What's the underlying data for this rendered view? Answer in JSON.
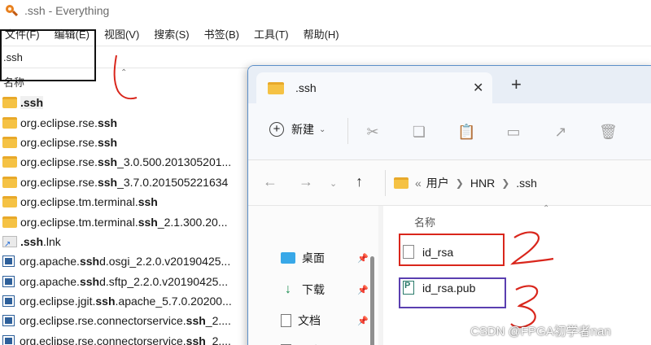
{
  "everything": {
    "title": ".ssh - Everything",
    "menu": [
      "文件(F)",
      "编辑(E)",
      "视图(V)",
      "搜索(S)",
      "书签(B)",
      "工具(T)",
      "帮助(H)"
    ],
    "search_value": ".ssh",
    "column_name": "名称",
    "rows": [
      {
        "icon": "folder",
        "pre": "",
        "bold": ".ssh",
        "post": "",
        "selected": true
      },
      {
        "icon": "folder",
        "pre": "org.eclipse.rse.",
        "bold": "ssh",
        "post": ""
      },
      {
        "icon": "folder",
        "pre": "org.eclipse.rse.",
        "bold": "ssh",
        "post": ""
      },
      {
        "icon": "folder",
        "pre": "org.eclipse.rse.",
        "bold": "ssh",
        "post": "_3.0.500.201305201..."
      },
      {
        "icon": "folder",
        "pre": "org.eclipse.rse.",
        "bold": "ssh",
        "post": "_3.7.0.201505221634"
      },
      {
        "icon": "folder",
        "pre": "org.eclipse.tm.terminal.",
        "bold": "ssh",
        "post": ""
      },
      {
        "icon": "folder",
        "pre": "org.eclipse.tm.terminal.",
        "bold": "ssh",
        "post": "_2.1.300.20..."
      },
      {
        "icon": "lnk",
        "pre": "",
        "bold": ".ssh",
        "post": ".lnk"
      },
      {
        "icon": "jar",
        "pre": "org.apache.",
        "bold": "ssh",
        "post": "d.osgi_2.2.0.v20190425..."
      },
      {
        "icon": "jar",
        "pre": "org.apache.",
        "bold": "ssh",
        "post": "d.sftp_2.2.0.v20190425..."
      },
      {
        "icon": "jar",
        "pre": "org.eclipse.jgit.",
        "bold": "ssh",
        "post": ".apache_5.7.0.20200..."
      },
      {
        "icon": "jar",
        "pre": "org.eclipse.rse.connectorservice.",
        "bold": "ssh",
        "post": "_2...."
      },
      {
        "icon": "jar",
        "pre": "org.eclipse.rse.connectorservice.",
        "bold": "ssh",
        "post": "_2...."
      }
    ]
  },
  "explorer": {
    "tab_title": ".ssh",
    "new_label": "新建",
    "breadcrumb": [
      "«",
      "用户",
      "HNR",
      ".ssh"
    ],
    "nav_items": [
      "桌面",
      "下载",
      "文档",
      "图片"
    ],
    "column_name": "名称",
    "files": [
      {
        "name": "id_rsa",
        "type": "file"
      },
      {
        "name": "id_rsa.pub",
        "type": "pub"
      }
    ]
  },
  "annotations": {
    "one": "1",
    "two": "2",
    "three": "3"
  },
  "watermark": "CSDN @FPGA初学者nan"
}
